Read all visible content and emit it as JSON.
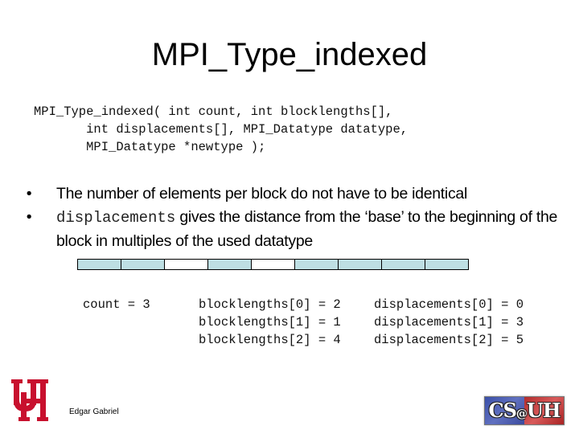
{
  "slide": {
    "title": "MPI_Type_indexed",
    "signature": [
      "MPI_Type_indexed( int count, int blocklengths[],",
      "       int displacements[], MPI_Datatype datatype,",
      "       MPI_Datatype *newtype );"
    ],
    "bullets": [
      {
        "marker": "•",
        "code": "",
        "text": "The number of elements per block do not have to be identical"
      },
      {
        "marker": "•",
        "code": "displacements",
        "text": " gives the distance from the ‘base’ to the beginning of the block in multiples of the used datatype"
      }
    ],
    "memory_layout": {
      "fill_color": "#bedfe3",
      "empty_color": "#ffffff",
      "cells": [
        "filled",
        "filled",
        "empty",
        "filled",
        "empty",
        "filled",
        "filled",
        "filled",
        "filled"
      ]
    },
    "example": {
      "count": "count = 3",
      "blocklengths": [
        "blocklengths[0] = 2",
        "blocklengths[1] = 1",
        "blocklengths[2] = 4"
      ],
      "displacements": [
        "displacements[0] = 0",
        "displacements[1] = 3",
        "displacements[2] = 5"
      ]
    }
  },
  "footer": {
    "author": "Edgar Gabriel",
    "uh_logo": {
      "icon": "uh-interlocking-logo",
      "color": "#c8102e"
    },
    "cs_logo": {
      "prefix": "CS",
      "at": "@",
      "suffix": "UH",
      "left_color": "#3a4fa8",
      "right_color": "#b22c2c"
    }
  }
}
